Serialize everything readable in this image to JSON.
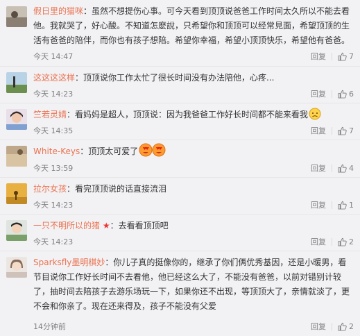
{
  "comments": [
    {
      "username": "假日里的猫咪",
      "separator": "：",
      "text": "虽然不想提伤心事。可今天看到顶顶说爸爸工作时间太久所以不能去看他。我就哭了，好心酸。不知道怎麽說，只希望你和顶顶可以经常見面，希望顶顶的生活有爸爸的陪伴，而你也有孩子想陪。希望你幸福，希望小顶顶快乐，希望他有爸爸。",
      "time": "今天 14:47",
      "reply": "回复",
      "likes": "7"
    },
    {
      "username": "这这这这样",
      "separator": "：",
      "text": "顶顶说你工作太忙了很长时间没有办法陪他，心疼...",
      "time": "今天 14:23",
      "reply": "回复",
      "likes": "6"
    },
    {
      "username": "竺若灵婧",
      "separator": "：",
      "text": "看妈妈是超人，顶顶说：因为我爸爸工作好长时间都不能来看我",
      "time": "今天 14:35",
      "reply": "回复",
      "likes": "7"
    },
    {
      "username": "White-Keys",
      "separator": "：",
      "text": "顶顶太可爱了",
      "time": "今天 13:59",
      "reply": "回复",
      "likes": "4"
    },
    {
      "username": "拉尔女孩",
      "separator": "：",
      "text": "看完顶顶说的话直接流泪",
      "time": "今天 14:23",
      "reply": "回复",
      "likes": "1"
    },
    {
      "username": "一只不明所以的猪",
      "separator": "：",
      "text": "去看看顶顶吧",
      "time": "今天 14:23",
      "reply": "回复",
      "likes": "2"
    },
    {
      "username": "Sparksfly墨明棋妙",
      "separator": "：",
      "text": "你儿子真的挺像你的，继承了你们俩优秀基因，还是小暖男，看节目说你工作好长时间不去看他，他已经这么大了，不能没有爸爸，以前对错别计较了，抽时间去陪孩子去游乐场玩一下，如果你还不出现，等顶顶大了，亲情就淡了，更不会和你亲了。现在还来得及，孩子不能没有父爱",
      "time": "14分钟前",
      "reply": "回复",
      "likes": "2"
    }
  ],
  "colors": {
    "username": "#eb7350",
    "meta": "#808080",
    "background": "#f2f2f5"
  }
}
